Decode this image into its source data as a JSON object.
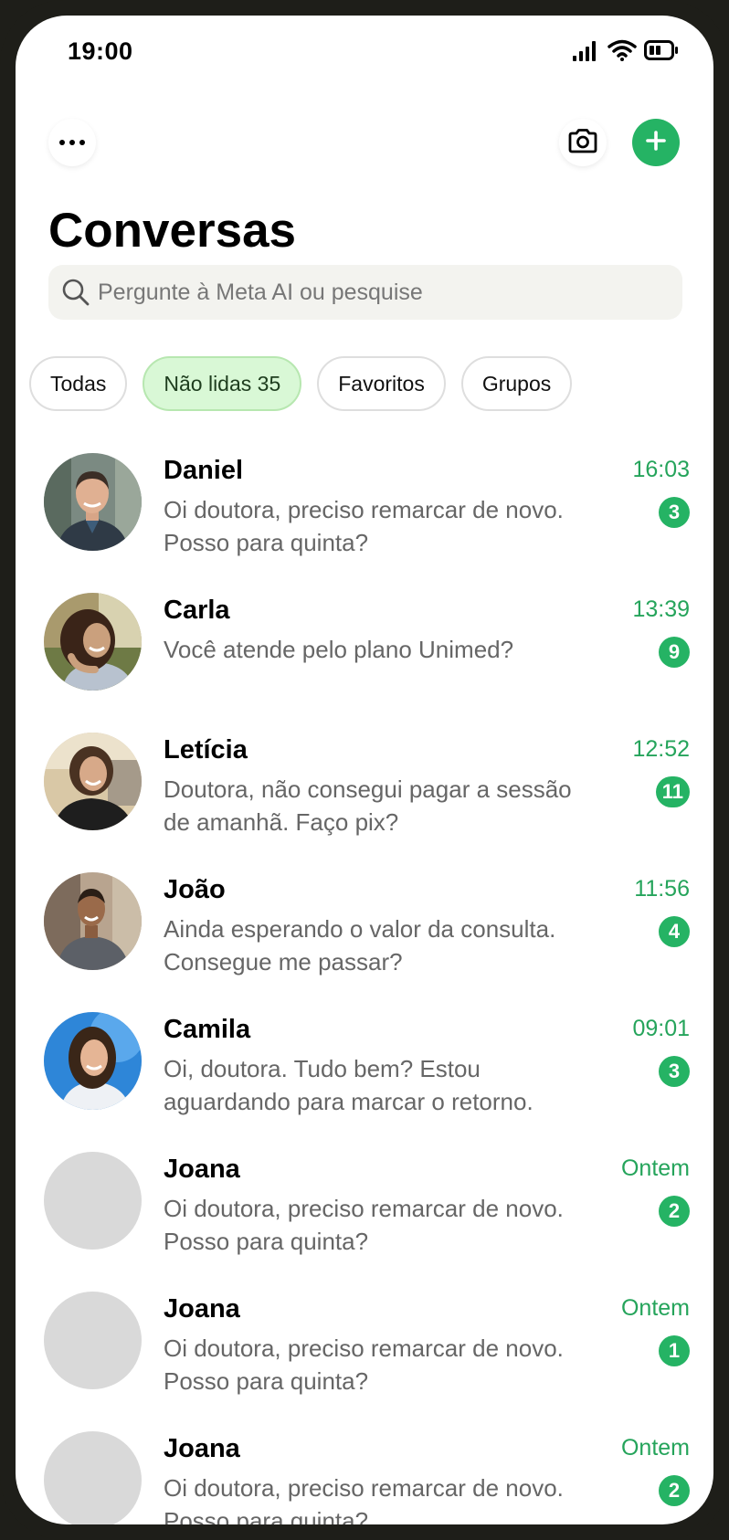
{
  "status_bar": {
    "time": "19:00"
  },
  "header": {
    "title": "Conversas"
  },
  "search": {
    "placeholder": "Pergunte à Meta AI ou pesquise"
  },
  "filters": [
    {
      "label": "Todas",
      "active": false
    },
    {
      "label": "Não lidas 35",
      "active": true
    },
    {
      "label": "Favoritos",
      "active": false
    },
    {
      "label": "Grupos",
      "active": false
    }
  ],
  "conversations": [
    {
      "name": "Daniel",
      "preview": "Oi doutora, preciso remarcar de novo. Posso para quinta?",
      "time": "16:03",
      "unread": "3",
      "avatar": "photo-daniel"
    },
    {
      "name": "Carla",
      "preview": "Você atende pelo plano Unimed?",
      "time": "13:39",
      "unread": "9",
      "avatar": "photo-carla"
    },
    {
      "name": "Letícia",
      "preview": "Doutora, não consegui pagar a sessão de amanhã. Faço pix?",
      "time": "12:52",
      "unread": "11",
      "avatar": "photo-leticia"
    },
    {
      "name": "João",
      "preview": "Ainda esperando o valor da consulta. Consegue me passar?",
      "time": "11:56",
      "unread": "4",
      "avatar": "photo-joao"
    },
    {
      "name": "Camila",
      "preview": "Oi, doutora. Tudo bem? Estou aguardando para marcar o retorno.",
      "time": "09:01",
      "unread": "3",
      "avatar": "photo-camila"
    },
    {
      "name": "Joana",
      "preview": "Oi doutora, preciso remarcar de novo. Posso para quinta?",
      "time": "Ontem",
      "unread": "2",
      "avatar": "placeholder"
    },
    {
      "name": "Joana",
      "preview": "Oi doutora, preciso remarcar de novo. Posso para quinta?",
      "time": "Ontem",
      "unread": "1",
      "avatar": "placeholder"
    },
    {
      "name": "Joana",
      "preview": "Oi doutora, preciso remarcar de novo. Posso para quinta?",
      "time": "Ontem",
      "unread": "2",
      "avatar": "placeholder"
    }
  ],
  "colors": {
    "accent": "#25b364",
    "time_text": "#25a45b",
    "chip_active_bg": "#d9f8d6"
  }
}
